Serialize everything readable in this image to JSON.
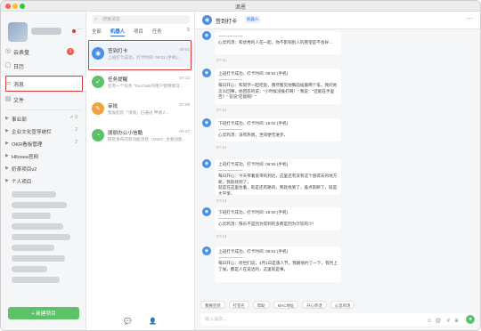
{
  "window": {
    "title": "滴恩"
  },
  "sidebar": {
    "user_suffix": "···",
    "nav": [
      {
        "label": "云表盘",
        "icon": "◎",
        "badge": "1",
        "icon_name": "dashboard-icon"
      },
      {
        "label": "日历",
        "icon": "▢",
        "badge": "",
        "icon_name": "calendar-icon"
      },
      {
        "label": "消息",
        "icon": "▭",
        "badge": "",
        "icon_name": "message-icon"
      },
      {
        "label": "文件",
        "icon": "▤",
        "badge": "",
        "icon_name": "file-icon"
      }
    ],
    "groups": [
      {
        "label": "事业部",
        "extra": "✔ 0"
      },
      {
        "label": "企业文化宣导统栏",
        "extra": "2"
      },
      {
        "label": "OKR看板管理",
        "extra": "2"
      },
      {
        "label": "Hitosea官网",
        "extra": ""
      },
      {
        "label": "奶茶项目v2",
        "extra": ""
      },
      {
        "label": "个人项目",
        "extra": ""
      }
    ],
    "new_button": "+ 新建项目"
  },
  "list": {
    "search_placeholder": "搜索消息",
    "tabs": [
      "全部",
      "机器人",
      "项目",
      "任务"
    ],
    "items": [
      {
        "name": "签到打卡",
        "time": "09:01",
        "preview": "上班打卡成功，打卡时间: 09:01 (手机)...",
        "color": "#4a8ee8",
        "icon": "◉"
      },
      {
        "name": "任务提醒",
        "time": "07:12",
        "preview": "您有一个任务 \"DooTask的用户使用情况...",
        "color": "#5cc26a",
        "icon": "✓"
      },
      {
        "name": "审批",
        "time": "07:09",
        "preview": "我发起的「请假」已通过 申请人...",
        "color": "#f0a33a",
        "icon": "✎"
      },
      {
        "name": "朋朋办公小信酷",
        "time": "04-27",
        "preview": "研究发布的新功能消息（2022）主要功能...",
        "color": "#5cc26a",
        "icon": "◔"
      }
    ]
  },
  "chat": {
    "title": "签到打卡",
    "tag": "机器人",
    "more": "···",
    "messages": [
      {
        "text": "------------------\n心灵鸡汤：和优秀的人在一起，你不影响别人的愿望是不会好...",
        "time": "07-11"
      },
      {
        "text": "上班打卡成功，打卡时间: 08:54 (手机)\n------------------\n每日开心：和同学一起吃饭，偶然看见他胸前插着两个笔，我问他怎么回事，他回答的说：\"小时候没挨打啊！\" 我说：\"还能在手里否？\" 答说\"还能啊！\"",
        "time": "07-12"
      },
      {
        "text": "下班打卡成功，打卡时间: 18:02 (手机)\n------------------\n心灵鸡汤：没有热情，世间便无进步。",
        "time": "07-12"
      },
      {
        "text": "上班打卡成功，打卡时间: 08:55 (手机)\n------------------\n每日开心：今天带着宽带的到达，这里还有没有这个值得去的地方呢，我就找到了，\n就是在这里住着，就是还有路的，我就找到了，差点就断了，就是大学里。",
        "time": "07-13"
      },
      {
        "text": "下班打卡成功，打卡时间: 18:00 (手机)\n------------------\n心灵鸡汤：快乐不是因为得到的多而是因为计较的少！",
        "time": "07-13"
      },
      {
        "text": "上班打卡成功，打卡时间: 09:01 (手机)\n------------------\n每日开心：听世们说，4月1日是愚人节，我跟他约了一下，有时上了候，都是人在说话的，这里就是事。",
        "time": ""
      }
    ],
    "quick_actions": [
      "我要签到",
      "打签名",
      "帮助",
      "MAC地址",
      "开心笑话",
      "心灵鸡汤"
    ],
    "input_placeholder": "输入消息..."
  }
}
